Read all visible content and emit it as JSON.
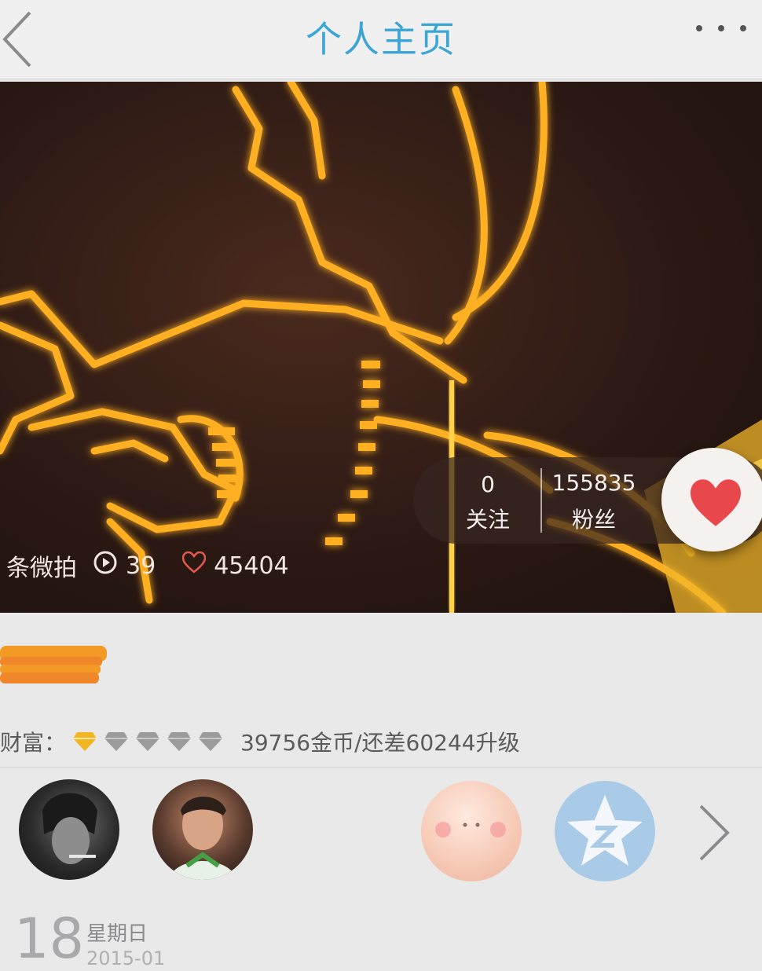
{
  "header": {
    "title": "个人主页"
  },
  "cover": {
    "posts_label": "条微拍",
    "play_count": "39",
    "like_count": "45404",
    "following_count": "0",
    "following_label": "关注",
    "fans_count": "155835",
    "fans_label": "粉丝"
  },
  "profile": {
    "wealth_label": "财富：",
    "wealth_text": "39756金币/还差60244升级",
    "date_day": "18",
    "date_weekday": "星期日",
    "date_year_month": "2015-01"
  },
  "colors": {
    "title_blue": "#3aa5d6",
    "heart_red": "#e8474b",
    "gem_gold": "#f3b623",
    "gem_gray": "#9b9b9b"
  },
  "icons": [
    "back-icon",
    "more-icon",
    "play-icon",
    "heart-outline-icon",
    "heart-icon",
    "diamond-icon",
    "chevron-right-icon",
    "qzone-star-icon"
  ]
}
